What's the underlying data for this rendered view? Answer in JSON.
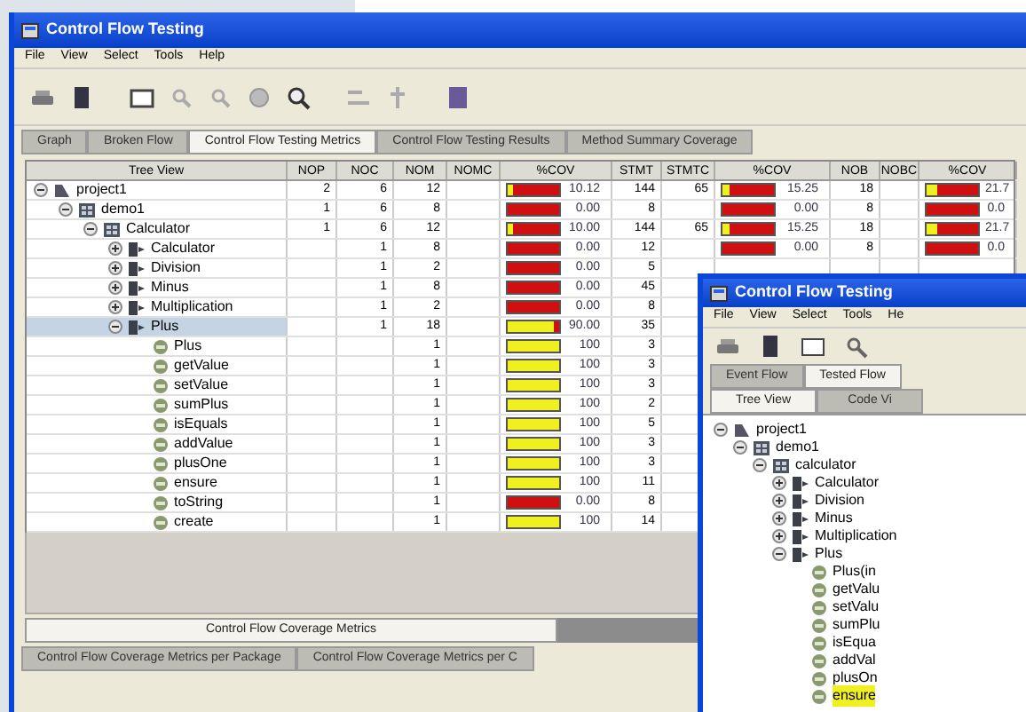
{
  "window": {
    "title": "Control Flow Testing"
  },
  "menu": [
    "File",
    "View",
    "Select",
    "Tools",
    "Help"
  ],
  "tabs": [
    {
      "label": "Graph",
      "selected": false
    },
    {
      "label": "Broken Flow",
      "selected": false
    },
    {
      "label": "Control Flow Testing Metrics",
      "selected": true
    },
    {
      "label": "Control Flow Testing Results",
      "selected": false
    },
    {
      "label": "Method Summary Coverage",
      "selected": false
    }
  ],
  "table": {
    "columns": [
      "Tree View",
      "NOP",
      "NOC",
      "NOM",
      "NOMC",
      "%COV",
      "STMT",
      "STMTC",
      "%COV",
      "NOB",
      "NOBC",
      "%COV"
    ],
    "rows": [
      {
        "name": "project1",
        "kind": "project",
        "expanded": true,
        "selected": false,
        "nop": "2",
        "noc": "6",
        "nom": "12",
        "cov1": {
          "level": 0.1,
          "reading": "10.12"
        },
        "stmt": "144",
        "stmtc": "65",
        "cov2": {
          "level": 0.15,
          "reading": "15.25"
        },
        "nob": "18",
        "cov3": {
          "level": 0.2,
          "reading": "21.7"
        },
        "children": [
          {
            "name": "demo1",
            "kind": "package",
            "expanded": true,
            "selected": false,
            "nop": "1",
            "noc": "6",
            "nom": "8",
            "cov1": {
              "level": 0,
              "reading": "0.00"
            },
            "stmt": "8",
            "cov2": {
              "level": 0,
              "reading": "0.00"
            },
            "nob": "8",
            "cov3": {
              "level": 0,
              "reading": "0.0"
            },
            "children": [
              {
                "name": "Calculator",
                "kind": "package",
                "expanded": true,
                "selected": false,
                "nop": "1",
                "noc": "6",
                "nom": "12",
                "cov1": {
                  "level": 0.1,
                  "reading": "10.00"
                },
                "stmt": "144",
                "stmtc": "65",
                "cov2": {
                  "level": 0.15,
                  "reading": "15.25"
                },
                "nob": "18",
                "cov3": {
                  "level": 0.2,
                  "reading": "21.7"
                },
                "children": [
                  {
                    "name": "Calculator",
                    "kind": "class",
                    "expanded": false,
                    "selected": false,
                    "noc": "1",
                    "nom": "8",
                    "cov1": {
                      "level": 0,
                      "reading": "0.00"
                    },
                    "stmt": "12",
                    "cov2": {
                      "level": 0,
                      "reading": "0.00"
                    },
                    "nob": "8",
                    "cov3": {
                      "level": 0,
                      "reading": "0.0"
                    }
                  },
                  {
                    "name": "Division",
                    "kind": "class",
                    "expanded": false,
                    "selected": false,
                    "noc": "1",
                    "nom": "2",
                    "cov1": {
                      "level": 0,
                      "reading": "0.00"
                    },
                    "stmt": "5"
                  },
                  {
                    "name": "Minus",
                    "kind": "class",
                    "expanded": false,
                    "selected": false,
                    "noc": "1",
                    "nom": "8",
                    "cov1": {
                      "level": 0,
                      "reading": "0.00"
                    },
                    "stmt": "45"
                  },
                  {
                    "name": "Multiplication",
                    "kind": "class",
                    "expanded": false,
                    "selected": false,
                    "noc": "1",
                    "nom": "2",
                    "cov1": {
                      "level": 0,
                      "reading": "0.00"
                    },
                    "stmt": "8"
                  },
                  {
                    "name": "Plus",
                    "kind": "class",
                    "expanded": true,
                    "selected": true,
                    "noc": "1",
                    "nom": "18",
                    "cov1": {
                      "level": 0.9,
                      "reading": "90.00"
                    },
                    "stmt": "35",
                    "children": [
                      {
                        "name": "Plus",
                        "kind": "method",
                        "selected": false,
                        "nom": "1",
                        "cov1": {
                          "level": 1,
                          "reading": "100"
                        },
                        "stmt": "3"
                      },
                      {
                        "name": "getValue",
                        "kind": "method",
                        "selected": false,
                        "nom": "1",
                        "cov1": {
                          "level": 1,
                          "reading": "100"
                        },
                        "stmt": "3"
                      },
                      {
                        "name": "setValue",
                        "kind": "method",
                        "selected": false,
                        "nom": "1",
                        "cov1": {
                          "level": 1,
                          "reading": "100"
                        },
                        "stmt": "3"
                      },
                      {
                        "name": "sumPlus",
                        "kind": "method",
                        "selected": false,
                        "nom": "1",
                        "cov1": {
                          "level": 1,
                          "reading": "100"
                        },
                        "stmt": "2"
                      },
                      {
                        "name": "isEquals",
                        "kind": "method",
                        "selected": false,
                        "nom": "1",
                        "cov1": {
                          "level": 1,
                          "reading": "100"
                        },
                        "stmt": "5"
                      },
                      {
                        "name": "addValue",
                        "kind": "method",
                        "selected": false,
                        "nom": "1",
                        "cov1": {
                          "level": 1,
                          "reading": "100"
                        },
                        "stmt": "3"
                      },
                      {
                        "name": "plusOne",
                        "kind": "method",
                        "selected": false,
                        "nom": "1",
                        "cov1": {
                          "level": 1,
                          "reading": "100"
                        },
                        "stmt": "3"
                      },
                      {
                        "name": "ensure",
                        "kind": "method",
                        "selected": false,
                        "nom": "1",
                        "cov1": {
                          "level": 1,
                          "reading": "100"
                        },
                        "stmt": "11"
                      },
                      {
                        "name": "toString",
                        "kind": "method",
                        "selected": false,
                        "nom": "1",
                        "cov1": {
                          "level": 0,
                          "reading": "0.00"
                        },
                        "stmt": "8"
                      },
                      {
                        "name": "create",
                        "kind": "method",
                        "selected": false,
                        "nom": "1",
                        "cov1": {
                          "level": 1,
                          "reading": "100"
                        },
                        "stmt": "14"
                      }
                    ]
                  }
                ]
              }
            ]
          }
        ]
      }
    ]
  },
  "panel_tab": {
    "label": "Control Flow Coverage Metrics",
    "selected": true
  },
  "bottom_tabs": [
    {
      "label": "Control Flow Coverage Metrics per Package",
      "selected": false
    },
    {
      "label": "Control Flow Coverage Metrics per C",
      "selected": false
    }
  ],
  "second_window": {
    "title": "Control Flow Testing",
    "menu": [
      "File",
      "View",
      "Select",
      "Tools",
      "He"
    ],
    "tabs": [
      {
        "label": "Event Flow",
        "selected": false
      },
      {
        "label": "Tested Flow",
        "selected": true
      }
    ],
    "subtabs": [
      {
        "label": "Tree View",
        "selected": true
      },
      {
        "label": "Code Vi",
        "selected": false
      }
    ],
    "tree": [
      {
        "name": "project1",
        "kind": "project",
        "expanded": true,
        "selected": false,
        "children": [
          {
            "name": "demo1",
            "kind": "package",
            "expanded": true,
            "selected": false,
            "children": [
              {
                "name": "calculator",
                "kind": "package",
                "expanded": true,
                "selected": false,
                "children": [
                  {
                    "name": "Calculator",
                    "kind": "class",
                    "expanded": false,
                    "selected": false
                  },
                  {
                    "name": "Division",
                    "kind": "class",
                    "expanded": false,
                    "selected": false
                  },
                  {
                    "name": "Minus",
                    "kind": "class",
                    "expanded": false,
                    "selected": false
                  },
                  {
                    "name": "Multiplication",
                    "kind": "class",
                    "expanded": false,
                    "selected": false
                  },
                  {
                    "name": "Plus",
                    "kind": "class",
                    "expanded": true,
                    "selected": false,
                    "children": [
                      {
                        "name": "Plus(in",
                        "kind": "method",
                        "selected": false
                      },
                      {
                        "name": "getValu",
                        "kind": "method",
                        "selected": false
                      },
                      {
                        "name": "setValu",
                        "kind": "method",
                        "selected": false
                      },
                      {
                        "name": "sumPlu",
                        "kind": "method",
                        "selected": false
                      },
                      {
                        "name": "isEqua",
                        "kind": "method",
                        "selected": false
                      },
                      {
                        "name": "addVal",
                        "kind": "method",
                        "selected": false
                      },
                      {
                        "name": "plusOn",
                        "kind": "method",
                        "selected": false
                      },
                      {
                        "name": "ensure",
                        "kind": "method",
                        "selected": true
                      }
                    ]
                  }
                ]
              }
            ]
          }
        ]
      }
    ]
  }
}
